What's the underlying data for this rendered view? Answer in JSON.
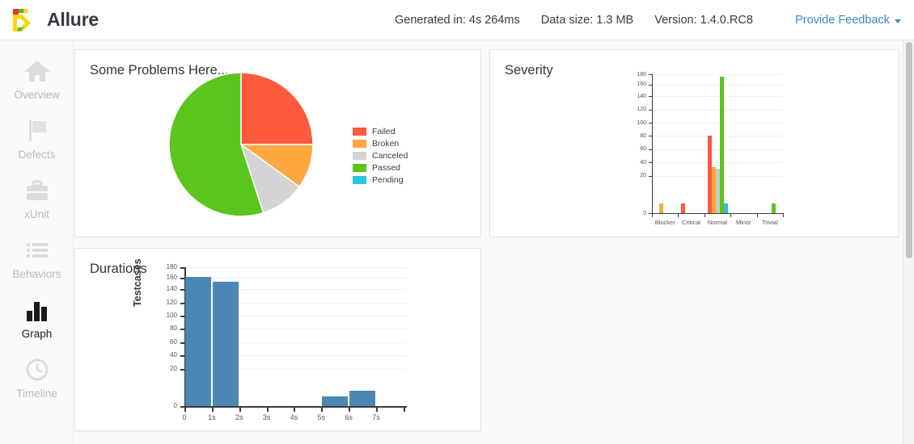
{
  "header": {
    "brand": "Allure",
    "logo_icon": "allure-logo-icon",
    "logo_colors": {
      "red": "#e8352b",
      "green": "#49b949",
      "yellow": "#f5d800"
    },
    "meta": [
      {
        "name": "generated-in",
        "text": "Generated in: 4s 264ms"
      },
      {
        "name": "data-size",
        "text": "Data size: 1.3 MB"
      },
      {
        "name": "version",
        "text": "Version: 1.4.0.RC8"
      }
    ],
    "feedback": {
      "label": "Provide Feedback",
      "icon": "chevron-down-icon",
      "color": "#3f87c9"
    }
  },
  "sidebar": {
    "items": [
      {
        "label": "Overview",
        "icon": "home-icon",
        "active": false
      },
      {
        "label": "Defects",
        "icon": "flag-icon",
        "active": false
      },
      {
        "label": "xUnit",
        "icon": "briefcase-icon",
        "active": false
      },
      {
        "label": "Behaviors",
        "icon": "list-icon",
        "active": false
      },
      {
        "label": "Graph",
        "icon": "bar-chart-icon",
        "active": true
      },
      {
        "label": "Timeline",
        "icon": "clock-icon",
        "active": false
      }
    ]
  },
  "colors": {
    "failed": "#fd5a3e",
    "broken": "#ffa73f",
    "canceled": "#d4d4d4",
    "passed": "#5ac51c",
    "pending": "#26c6da",
    "duration_bar": "#4a87b5"
  },
  "panels": {
    "pie_title": "Some Problems Here...",
    "severity_title": "Severity",
    "durations_title": "Durations"
  },
  "chart_data": [
    {
      "type": "pie",
      "name": "status-pie-chart",
      "title": "Some Problems Here...",
      "legend_position": "right",
      "labels": [
        "Failed",
        "Broken",
        "Canceled",
        "Passed",
        "Pending"
      ],
      "values": [
        25,
        10,
        10,
        55,
        0
      ],
      "colors": [
        "#fd5a3e",
        "#ffa73f",
        "#d4d4d4",
        "#5ac51c",
        "#26c6da"
      ],
      "units": "percent"
    },
    {
      "type": "bar",
      "name": "severity-bar-chart",
      "title": "Severity",
      "xlabel": "",
      "ylabel": "",
      "ylim": [
        0,
        180
      ],
      "yticks": [
        0,
        20,
        40,
        60,
        80,
        100,
        120,
        140,
        160,
        180
      ],
      "grid": true,
      "categories": [
        "Blocker",
        "Critical",
        "Normal",
        "Minor",
        "Trivial"
      ],
      "series": [
        {
          "name": "Failed",
          "color": "#fd5a3e",
          "values": [
            0,
            5,
            80,
            0,
            0
          ]
        },
        {
          "name": "Broken",
          "color": "#ffa73f",
          "values": [
            5,
            0,
            33,
            0,
            0
          ]
        },
        {
          "name": "Canceled",
          "color": "#c9c9c9",
          "values": [
            0,
            0,
            30,
            0,
            0
          ]
        },
        {
          "name": "Passed",
          "color": "#5ac51c",
          "values": [
            0,
            0,
            175,
            0,
            5
          ]
        },
        {
          "name": "Pending",
          "color": "#35bcd6",
          "values": [
            0,
            0,
            5,
            0,
            0
          ]
        }
      ]
    },
    {
      "type": "bar",
      "name": "durations-bar-chart",
      "title": "Durations",
      "xlabel": "",
      "ylabel": "Testcases",
      "ylim": [
        0,
        180
      ],
      "yticks": [
        0,
        20,
        40,
        60,
        80,
        100,
        120,
        140,
        160,
        180
      ],
      "grid": true,
      "xticks": [
        "0",
        "1s",
        "2s",
        "3s",
        "4s",
        "5s",
        "6s",
        "7s"
      ],
      "bins": [
        {
          "from": "0",
          "to": "1s",
          "value": 161
        },
        {
          "from": "1s",
          "to": "2s",
          "value": 153
        },
        {
          "from": "2s",
          "to": "3s",
          "value": 0
        },
        {
          "from": "3s",
          "to": "4s",
          "value": 0
        },
        {
          "from": "4s",
          "to": "5s",
          "value": 0
        },
        {
          "from": "5s",
          "to": "6s",
          "value": 5
        },
        {
          "from": "6s",
          "to": "7s",
          "value": 8
        }
      ],
      "color": "#4a87b5"
    }
  ]
}
